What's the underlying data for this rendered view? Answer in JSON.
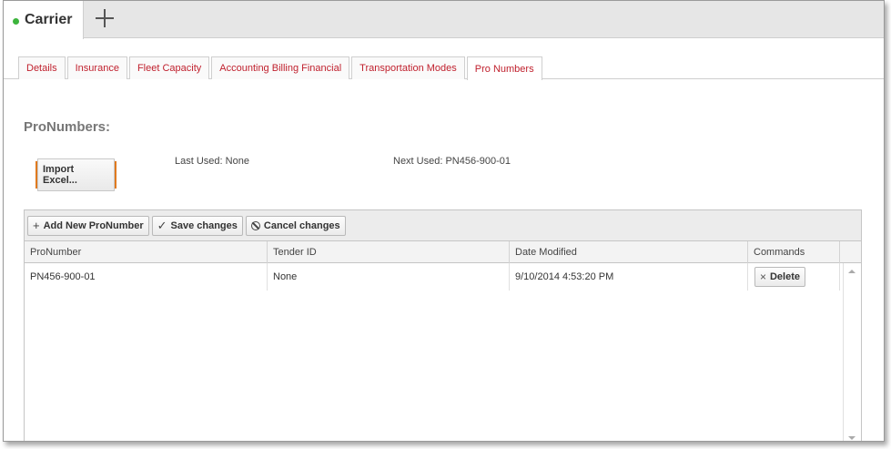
{
  "header": {
    "tab_title": "Carrier",
    "status_color": "#3cb43c",
    "add_icon": "plus-icon"
  },
  "subtabs": [
    {
      "label": "Details",
      "active": false
    },
    {
      "label": "Insurance",
      "active": false
    },
    {
      "label": "Fleet Capacity",
      "active": false
    },
    {
      "label": "Accounting Billing Financial",
      "active": false
    },
    {
      "label": "Transportation Modes",
      "active": false
    },
    {
      "label": "Pro Numbers",
      "active": true
    }
  ],
  "section": {
    "title": "ProNumbers:",
    "import_label": "Import Excel...",
    "last_used": "Last Used:  None",
    "next_used": "Next Used:  PN456-900-01"
  },
  "toolbar": {
    "add_label": "Add New ProNumber",
    "save_label": "Save changes",
    "cancel_label": "Cancel changes"
  },
  "grid": {
    "columns": [
      "ProNumber",
      "Tender ID",
      "Date Modified",
      "Commands"
    ],
    "rows": [
      {
        "pronumber": "PN456-900-01",
        "tender_id": "None",
        "date_modified": "9/10/2014 4:53:20 PM",
        "command": "Delete"
      }
    ]
  },
  "colors": {
    "tab_text": "#c0212e",
    "highlight": "#e07a1f"
  }
}
